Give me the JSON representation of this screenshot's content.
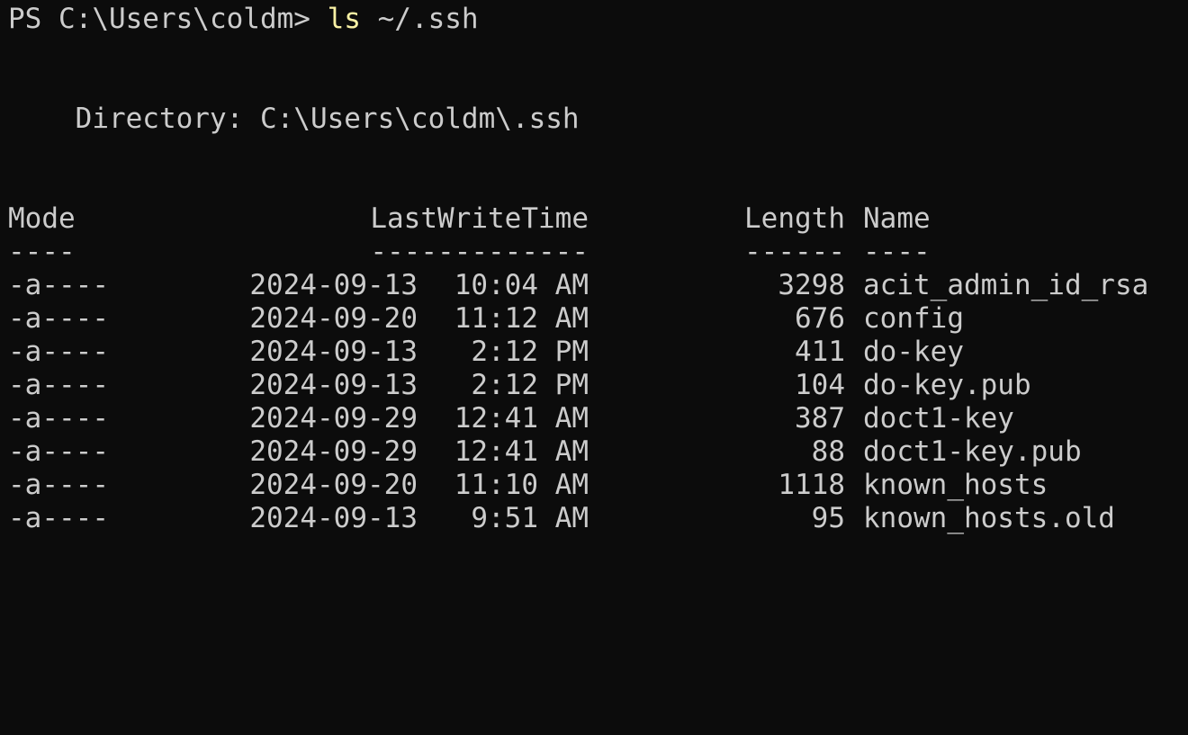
{
  "prompt": {
    "text": "PS C:\\Users\\coldm> ",
    "command": "ls",
    "argument": " ~/.ssh"
  },
  "directory_line": "    Directory: C:\\Users\\coldm\\.ssh",
  "table": {
    "headers": {
      "mode": "Mode",
      "lastwritetime": "LastWriteTime",
      "length": "Length",
      "name": "Name"
    },
    "underlines": {
      "mode": "----",
      "lastwritetime": "-------------",
      "length": "------",
      "name": "----"
    },
    "rows": [
      {
        "mode": "-a----",
        "date": "2024-09-13",
        "time": "10:04 AM",
        "length": "3298",
        "name": "acit_admin_id_rsa"
      },
      {
        "mode": "-a----",
        "date": "2024-09-20",
        "time": "11:12 AM",
        "length": "676",
        "name": "config"
      },
      {
        "mode": "-a----",
        "date": "2024-09-13",
        "time": "2:12 PM",
        "length": "411",
        "name": "do-key"
      },
      {
        "mode": "-a----",
        "date": "2024-09-13",
        "time": "2:12 PM",
        "length": "104",
        "name": "do-key.pub"
      },
      {
        "mode": "-a----",
        "date": "2024-09-29",
        "time": "12:41 AM",
        "length": "387",
        "name": "doct1-key"
      },
      {
        "mode": "-a----",
        "date": "2024-09-29",
        "time": "12:41 AM",
        "length": "88",
        "name": "doct1-key.pub"
      },
      {
        "mode": "-a----",
        "date": "2024-09-20",
        "time": "11:10 AM",
        "length": "1118",
        "name": "known_hosts"
      },
      {
        "mode": "-a----",
        "date": "2024-09-13",
        "time": "9:51 AM",
        "length": "95",
        "name": "known_hosts.old"
      }
    ]
  },
  "colors": {
    "background": "#0c0c0c",
    "foreground": "#cccccc",
    "command": "#f9f1a5"
  }
}
